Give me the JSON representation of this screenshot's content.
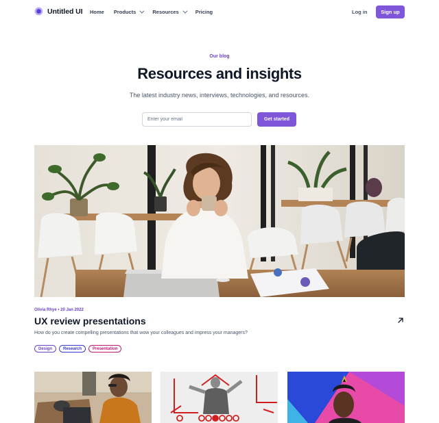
{
  "nav": {
    "brand": "Untitled UI",
    "links": [
      {
        "label": "Home"
      },
      {
        "label": "Products"
      },
      {
        "label": "Resources"
      },
      {
        "label": "Pricing"
      }
    ],
    "login": "Log in",
    "signup": "Sign up"
  },
  "hero": {
    "eyebrow": "Our blog",
    "title": "Resources and insights",
    "subtitle": "The latest industry news, interviews, technologies, and resources.",
    "email_placeholder": "Enter your email",
    "cta": "Get started"
  },
  "featured": {
    "meta": "Olivia Rhye • 20 Jan 2022",
    "title": "UX review presentations",
    "excerpt": "How do you create compelling presentations that wow your colleagues and impress your managers?",
    "tags": [
      {
        "label": "Design",
        "color": "#6941c6"
      },
      {
        "label": "Research",
        "color": "#3538cd"
      },
      {
        "label": "Presentation",
        "color": "#c11574"
      }
    ]
  },
  "colors": {
    "primary": "#7f56d9",
    "primary_text": "#6941c6"
  }
}
